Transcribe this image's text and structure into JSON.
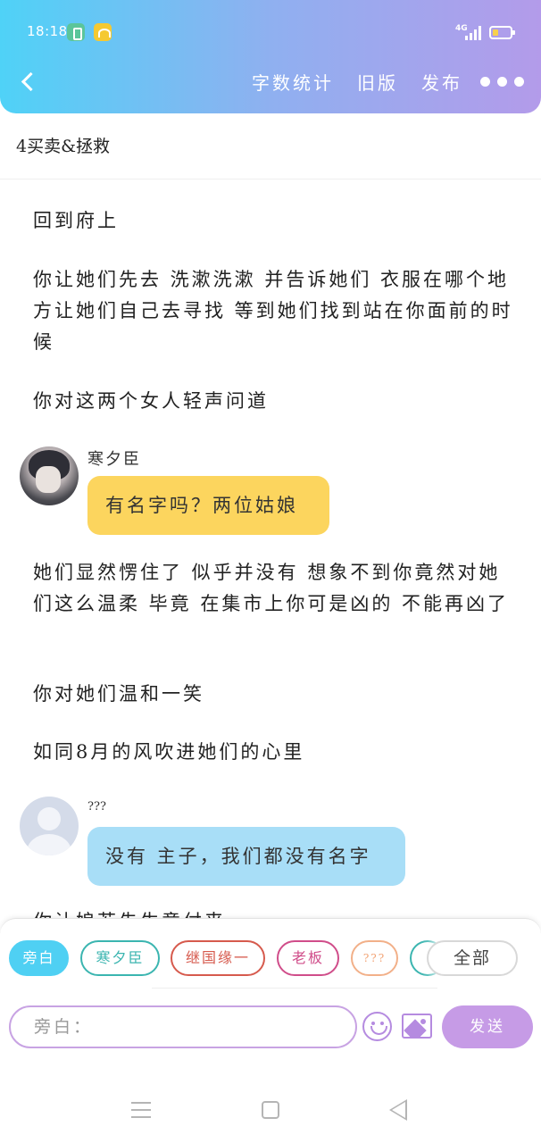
{
  "status_bar": {
    "time": "18:18",
    "network": "4G"
  },
  "header": {
    "actions": {
      "word_count": "字数统计",
      "old_version": "旧版",
      "publish": "发布"
    }
  },
  "chapter": {
    "title": "4买卖&拯救"
  },
  "story": {
    "p1": "回到府上",
    "p2": "你让她们先去 洗漱洗漱 并告诉她们 衣服在哪个地方让她们自己去寻找 等到她们找到站在你面前的时候",
    "p3": "你对这两个女人轻声问道",
    "dialog1": {
      "speaker": "寒夕臣",
      "text": "有名字吗？两位姑娘"
    },
    "p4": "她们显然愣住了 似乎并没有 想象不到你竟然对她们这么温柔 毕竟 在集市上你可是凶的 不能再凶了",
    "p5": "你对她们温和一笑",
    "p6": "如同8月的风吹进她们的心里",
    "dialog2": {
      "speaker": "???",
      "text": "没有 主子，我们都没有名字"
    },
    "p7_partial": "你让娘若先生意付来"
  },
  "roles": {
    "pangbai": "旁白",
    "hanxi": "寒夕臣",
    "jiguo": "继国缘一",
    "laoban": "老板",
    "unknown": "???",
    "all": "全部"
  },
  "composer": {
    "placeholder": "旁白：",
    "send_label": "发送"
  }
}
